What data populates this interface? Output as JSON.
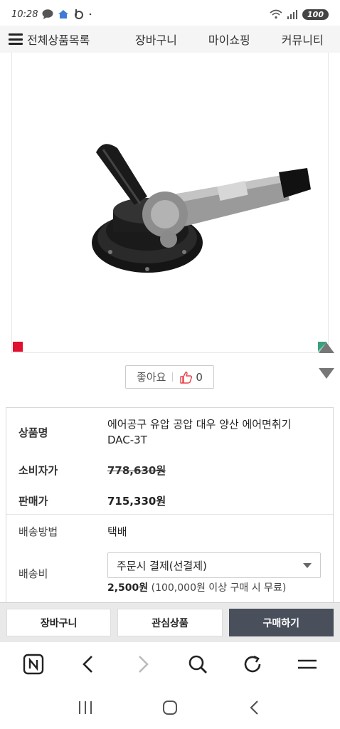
{
  "status_bar": {
    "time": "10:28",
    "battery": "100",
    "icons": [
      "chat-icon",
      "home-icon",
      "b-app-icon",
      "dot-icon",
      "wifi-icon",
      "signal-icon"
    ]
  },
  "top_nav": {
    "menu_label": "전체상품목록",
    "links": [
      "장바구니",
      "마이쇼핑",
      "커뮤니티"
    ]
  },
  "product": {
    "image_alt": "에어면취기 product image",
    "like_label": "좋아요",
    "like_count": "0"
  },
  "info": {
    "name_label": "상품명",
    "name_value": "에어공구 유압 공압 대우 양산 에어면취기 DAC-3T",
    "name_line1": "에어공구 유압 공압 대우 양산 에어면취기",
    "name_line2": "DAC-3T",
    "consumer_label": "소비자가",
    "consumer_price": "778,630원",
    "sale_label": "판매가",
    "sale_price": "715,330원",
    "delivery_method_label": "배송방법",
    "delivery_method_value": "택배",
    "shipping_fee_label": "배송비",
    "shipping_select_value": "주문시 결제(선결제)",
    "shipping_fee_amount": "2,500원",
    "shipping_fee_note": "(100,000원 이상 구매 시 무료)"
  },
  "actions": {
    "cart": "장바구니",
    "wishlist": "관심상품",
    "buy": "구매하기"
  },
  "browser_bar": {
    "icons": [
      "naver-n-icon",
      "back-icon",
      "forward-icon",
      "search-icon",
      "refresh-icon",
      "menu-icon"
    ]
  },
  "system_nav": {
    "icons": [
      "recent-apps-icon",
      "home-circle-icon",
      "back-chevron-icon"
    ]
  },
  "colors": {
    "buy_button": "#4a4f5c",
    "marker_red": "#e0102f",
    "marker_green": "#3aa07e"
  }
}
